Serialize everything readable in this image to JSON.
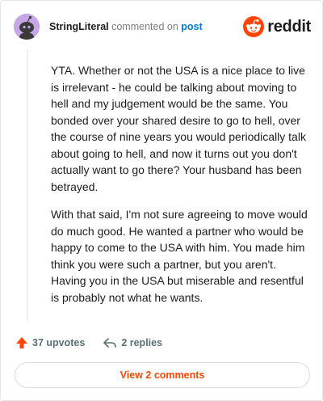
{
  "header": {
    "username": "StringLiteral",
    "verb": "commented on",
    "post_link": "post",
    "brand": "reddit"
  },
  "comment": {
    "paragraphs": [
      "YTA. Whether or not the USA is a nice place to live is irrelevant - he could be talking about moving to hell and my judgement would be the same. You bonded over your shared desire to go to hell, over the course of nine years you would periodically talk about going to hell, and now it turns out you don't actually want to go there? Your husband has been betrayed.",
      "With that said, I'm not sure agreeing to move would do much good. He wanted a partner who would be happy to come to the USA with him. You made him think you were such a partner, but you aren't. Having you in the USA but miserable and resentful is probably not what he wants."
    ]
  },
  "actions": {
    "upvotes": "37 upvotes",
    "replies": "2 replies"
  },
  "footer": {
    "view_comments": "View 2 comments"
  },
  "colors": {
    "brand_orange": "#ff4500",
    "link_blue": "#0079d3",
    "avatar_bg": "#c5a6e6"
  },
  "icons": {
    "avatar": "snoo-avatar-icon",
    "brand": "reddit-logo-icon",
    "upvote": "upvote-arrow-icon",
    "reply": "reply-icon"
  }
}
